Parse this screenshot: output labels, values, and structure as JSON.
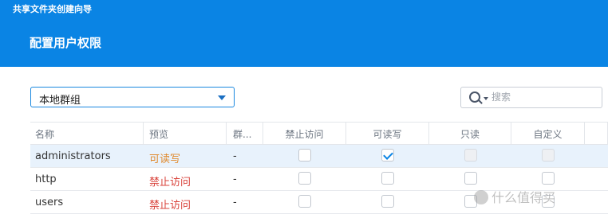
{
  "header": {
    "wizard_title": "共享文件夹创建向导",
    "step_title": "配置用户权限",
    "color": "#0a84e4"
  },
  "filter": {
    "group_select_value": "本地群组",
    "search_placeholder": "搜索",
    "search_icon": "magnifier-dropdown-icon"
  },
  "table": {
    "columns": [
      "名称",
      "预览",
      "群...",
      "禁止访问",
      "可读写",
      "只读",
      "自定义"
    ],
    "rows": [
      {
        "name": "administrators",
        "preview": "可读写",
        "preview_color": "#e08a2e",
        "group": "-",
        "deny": false,
        "rw": true,
        "ro": false,
        "custom": false
      },
      {
        "name": "http",
        "preview": "禁止访问",
        "preview_color": "#d9433b",
        "group": "-",
        "deny": false,
        "rw": false,
        "ro": false,
        "custom": false
      },
      {
        "name": "users",
        "preview": "禁止访问",
        "preview_color": "#d9433b",
        "group": "-",
        "deny": false,
        "rw": false,
        "ro": false,
        "custom": false
      }
    ]
  },
  "watermark": {
    "text": "什么值得买"
  }
}
